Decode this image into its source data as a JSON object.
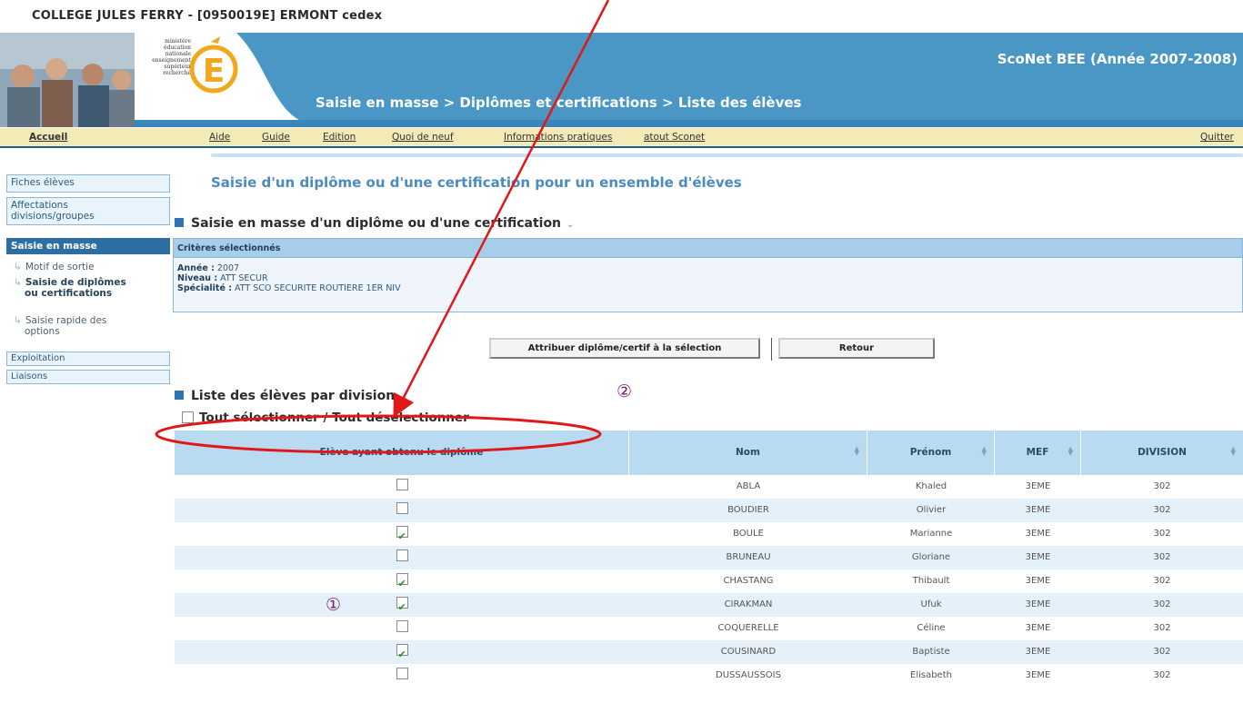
{
  "school_title": "COLLEGE JULES FERRY - [0950019E] ERMONT cedex",
  "banner": {
    "app_name": "ScoNet BEE (Année 2007-2008)",
    "breadcrumb": "Saisie en masse > Diplômes et certifications > Liste des élèves",
    "logo_lines": [
      "ministère",
      "éducation",
      "nationale",
      "enseignement",
      "supérieur",
      "recherche"
    ]
  },
  "menu": [
    "Accueil",
    "Aide",
    "Guide",
    "Edition",
    "Quoi de neuf",
    "Informations pratiques",
    "atout Sconet",
    "Quitter"
  ],
  "sidebar": {
    "fiches": "Fiches élèves",
    "affectations": [
      "Affectations",
      "divisions/groupes"
    ],
    "saisie_masse": "Saisie en masse",
    "motif": "Motif de sortie",
    "diplomes": [
      "Saisie de diplômes",
      "ou certifications"
    ],
    "options": [
      "Saisie rapide des",
      "options"
    ],
    "exploitation": "Exploitation",
    "liaisons": "Liaisons"
  },
  "page_heading": "Saisie d'un diplôme ou d'une certification pour un ensemble d'élèves",
  "section1_title": "Saisie en masse d'un diplôme ou d'une certification",
  "criteria": {
    "header": "Critères sélectionnés",
    "annee_label": "Année :",
    "annee": "2007",
    "niveau_label": "Niveau :",
    "niveau": "ATT SECUR",
    "specialite_label": "Spécialité :",
    "specialite": "ATT SCO SECURITE ROUTIERE 1ER NIV"
  },
  "buttons": {
    "attribuer": "Attribuer diplôme/certif à la sélection",
    "retour": "Retour"
  },
  "section2_title": "Liste des élèves par division",
  "select_all": "Tout sélectionner / Tout désélectionner",
  "markers": {
    "one": "①",
    "two": "②"
  },
  "table": {
    "headers": [
      "Elève ayant obtenu le diplôme",
      "Nom",
      "Prénom",
      "MEF",
      "DIVISION"
    ],
    "rows": [
      {
        "checked": false,
        "nom": "ABLA",
        "prenom": "Khaled",
        "mef": "3EME",
        "division": "302"
      },
      {
        "checked": false,
        "nom": "BOUDIER",
        "prenom": "Olivier",
        "mef": "3EME",
        "division": "302"
      },
      {
        "checked": true,
        "nom": "BOULE",
        "prenom": "Marianne",
        "mef": "3EME",
        "division": "302"
      },
      {
        "checked": false,
        "nom": "BRUNEAU",
        "prenom": "Gloriane",
        "mef": "3EME",
        "division": "302"
      },
      {
        "checked": true,
        "nom": "CHASTANG",
        "prenom": "Thibault",
        "mef": "3EME",
        "division": "302"
      },
      {
        "checked": true,
        "nom": "CIRAKMAN",
        "prenom": "Ufuk",
        "mef": "3EME",
        "division": "302"
      },
      {
        "checked": false,
        "nom": "COQUERELLE",
        "prenom": "Céline",
        "mef": "3EME",
        "division": "302"
      },
      {
        "checked": true,
        "nom": "COUSINARD",
        "prenom": "Baptiste",
        "mef": "3EME",
        "division": "302"
      },
      {
        "checked": false,
        "nom": "DUSSAUSSOIS",
        "prenom": "Elisabeth",
        "mef": "3EME",
        "division": "302"
      }
    ]
  },
  "colors": {
    "banner_blue": "#4a97c6",
    "accent_blue": "#2d6fa3",
    "annotation_red": "#e01818",
    "marker_purple": "#7a1f6f"
  }
}
